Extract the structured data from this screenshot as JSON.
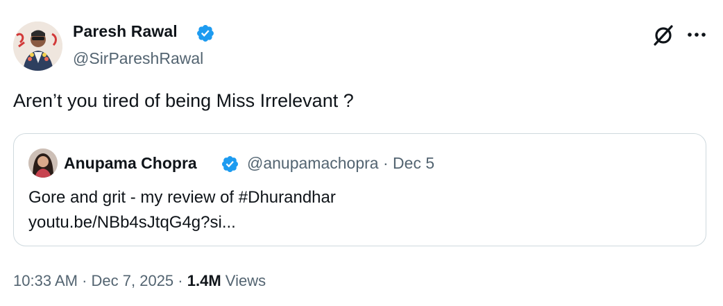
{
  "author": {
    "name": "Paresh Rawal",
    "handle": "@SirPareshRawal",
    "verified": true
  },
  "tweet": {
    "text": "Aren’t you tired of being Miss Irrelevant ?"
  },
  "quoted": {
    "name": "Anupama Chopra",
    "verified": true,
    "handle": "@anupamachopra",
    "separator": "·",
    "date": "Dec 5",
    "text_line1": "Gore and grit - my review of #Dhurandhar",
    "text_line2": "youtu.be/NBb4sJtqG4g?si..."
  },
  "footer": {
    "time": "10:33 AM",
    "date": "Dec 7, 2025",
    "separator": "·",
    "views_count": "1.4M",
    "views_label": "Views"
  },
  "colors": {
    "verified": "#1d9bf0",
    "secondary_text": "#536471",
    "border": "#cfd9de"
  },
  "icons": {
    "header_right": [
      "grok-icon",
      "more-icon"
    ]
  }
}
